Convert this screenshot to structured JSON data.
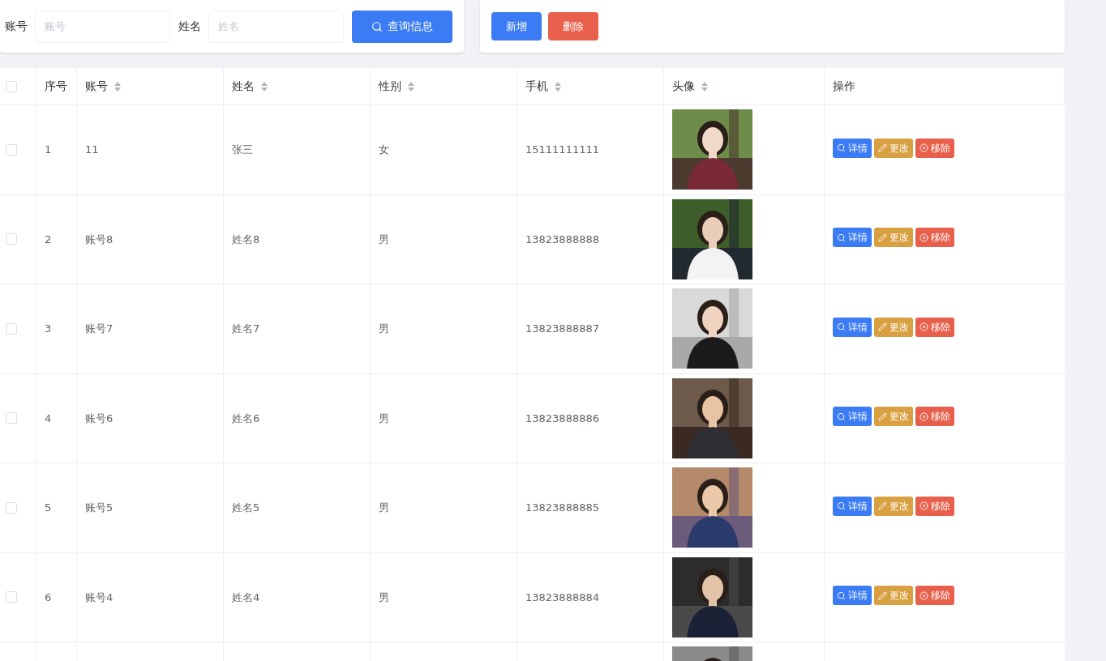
{
  "search": {
    "fields": [
      {
        "label": "账号",
        "placeholder": "账号"
      },
      {
        "label": "姓名",
        "placeholder": "姓名"
      }
    ],
    "button": "查询信息"
  },
  "actions": [
    {
      "label": "新增",
      "kind": "primary"
    },
    {
      "label": "删除",
      "kind": "danger"
    }
  ],
  "table": {
    "select_all": {
      "checked": false
    },
    "columns": [
      {
        "label": "序号",
        "sortable": false
      },
      {
        "label": "账号",
        "sortable": true
      },
      {
        "label": "姓名",
        "sortable": true
      },
      {
        "label": "性别",
        "sortable": true
      },
      {
        "label": "手机",
        "sortable": true
      },
      {
        "label": "头像",
        "sortable": true
      },
      {
        "label": "操作",
        "sortable": false
      }
    ],
    "rows": [
      {
        "checked": false,
        "cells": [
          "1",
          "11",
          "张三",
          "女",
          "15111111111"
        ],
        "avatar": {
          "kind": "picture"
        },
        "actions": [
          {
            "label": "详情",
            "kind": "view"
          },
          {
            "label": "更改",
            "kind": "edit"
          },
          {
            "label": "移除",
            "kind": "remove"
          }
        ]
      },
      {
        "checked": false,
        "cells": [
          "2",
          "账号8",
          "姓名8",
          "男",
          "13823888888"
        ],
        "avatar": {
          "kind": "picture"
        },
        "actions": [
          {
            "label": "详情",
            "kind": "view"
          },
          {
            "label": "更改",
            "kind": "edit"
          },
          {
            "label": "移除",
            "kind": "remove"
          }
        ]
      },
      {
        "checked": false,
        "cells": [
          "3",
          "账号7",
          "姓名7",
          "男",
          "13823888887"
        ],
        "avatar": {
          "kind": "picture"
        },
        "actions": [
          {
            "label": "详情",
            "kind": "view"
          },
          {
            "label": "更改",
            "kind": "edit"
          },
          {
            "label": "移除",
            "kind": "remove"
          }
        ]
      },
      {
        "checked": false,
        "cells": [
          "4",
          "账号6",
          "姓名6",
          "男",
          "13823888886"
        ],
        "avatar": {
          "kind": "picture"
        },
        "actions": [
          {
            "label": "详情",
            "kind": "view"
          },
          {
            "label": "更改",
            "kind": "edit"
          },
          {
            "label": "移除",
            "kind": "remove"
          }
        ]
      },
      {
        "checked": false,
        "cells": [
          "5",
          "账号5",
          "姓名5",
          "男",
          "13823888885"
        ],
        "avatar": {
          "kind": "picture"
        },
        "actions": [
          {
            "label": "详情",
            "kind": "view"
          },
          {
            "label": "更改",
            "kind": "edit"
          },
          {
            "label": "移除",
            "kind": "remove"
          }
        ]
      },
      {
        "checked": false,
        "cells": [
          "6",
          "账号4",
          "姓名4",
          "男",
          "13823888884"
        ],
        "avatar": {
          "kind": "picture"
        },
        "actions": [
          {
            "label": "详情",
            "kind": "view"
          },
          {
            "label": "更改",
            "kind": "edit"
          },
          {
            "label": "移除",
            "kind": "remove"
          }
        ]
      }
    ]
  }
}
